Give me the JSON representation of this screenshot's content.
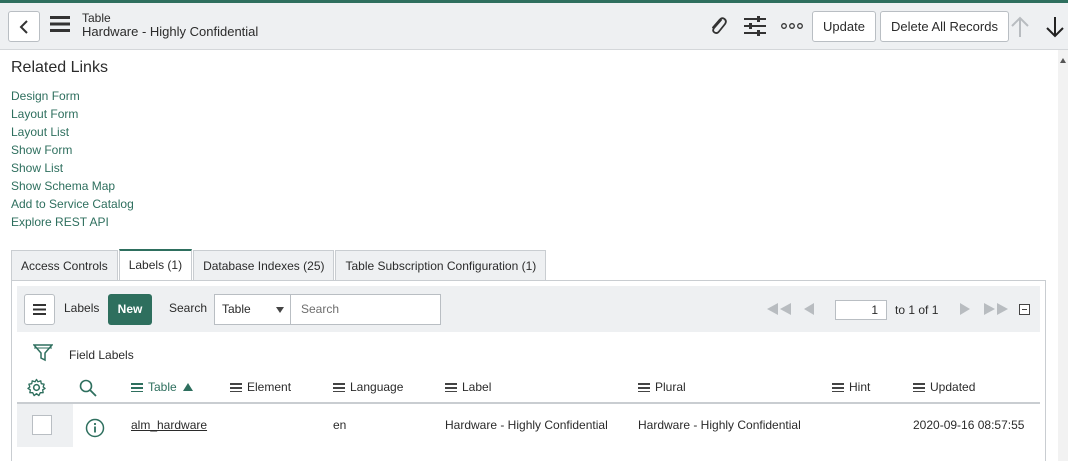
{
  "header": {
    "subtitle": "Table",
    "title": "Hardware - Highly Confidential",
    "update_label": "Update",
    "delete_all_label": "Delete All Records"
  },
  "related": {
    "title": "Related Links",
    "links": [
      "Design Form",
      "Layout Form",
      "Layout List",
      "Show Form",
      "Show List",
      "Show Schema Map",
      "Add to Service Catalog",
      "Explore REST API"
    ]
  },
  "tabs": [
    "Access Controls",
    "Labels (1)",
    "Database Indexes (25)",
    "Table Subscription Configuration (1)"
  ],
  "list": {
    "labels_text": "Labels",
    "new_label": "New",
    "search_label": "Search",
    "search_field": "Table",
    "search_placeholder": "Search",
    "page_value": "1",
    "page_of": "to 1 of 1",
    "breadcrumb": "Field Labels",
    "columns": [
      "Table",
      "Element",
      "Language",
      "Label",
      "Plural",
      "Hint",
      "Updated"
    ],
    "rows": [
      {
        "table": "alm_hardware",
        "element": "",
        "language": "en",
        "label": "Hardware - Highly Confidential",
        "plural": "Hardware - Highly Confidential",
        "hint": "",
        "updated": "2020-09-16 08:57:55"
      }
    ]
  },
  "colors": {
    "accent": "#2e6f5e",
    "header_bg": "#eef0f2"
  }
}
